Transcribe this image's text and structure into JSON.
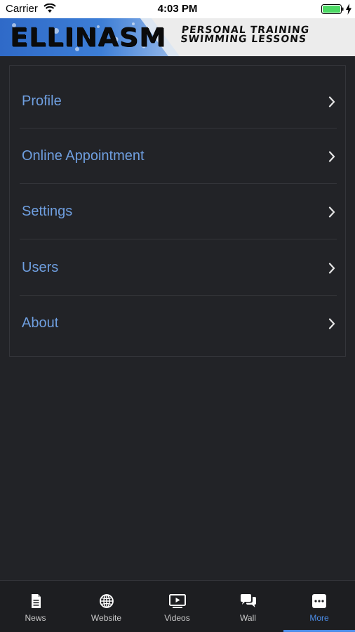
{
  "status_bar": {
    "carrier": "Carrier",
    "time": "4:03 PM"
  },
  "banner": {
    "logo_text": "ELLINASM",
    "tagline_line1": "PERSONAL TRAINING",
    "tagline_line2": "SWIMMING LESSONS"
  },
  "menu": {
    "items": [
      {
        "label": "Profile"
      },
      {
        "label": "Online Appointment"
      },
      {
        "label": "Settings"
      },
      {
        "label": "Users"
      },
      {
        "label": "About"
      }
    ]
  },
  "tab_bar": {
    "tabs": [
      {
        "label": "News",
        "icon": "document-icon"
      },
      {
        "label": "Website",
        "icon": "globe-icon"
      },
      {
        "label": "Videos",
        "icon": "video-icon"
      },
      {
        "label": "Wall",
        "icon": "chat-icon"
      },
      {
        "label": "More",
        "icon": "more-icon",
        "active": true
      }
    ]
  },
  "colors": {
    "background": "#222327",
    "menu_text": "#6f9fe0",
    "active_tab": "#4c8de8",
    "battery": "#4cd964"
  }
}
